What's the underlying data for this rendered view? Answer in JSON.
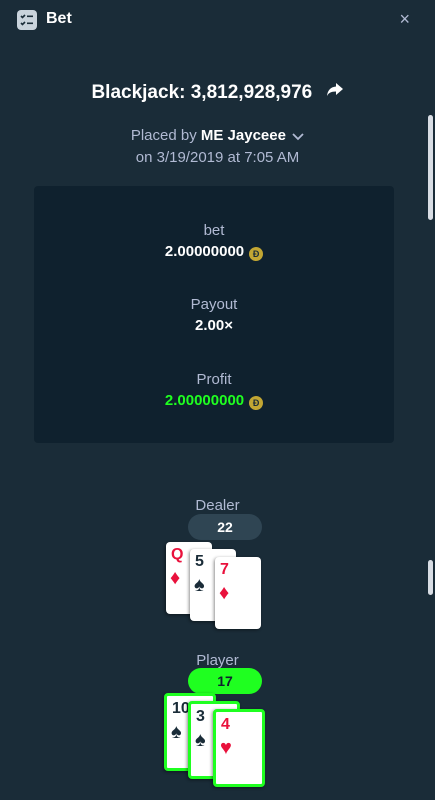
{
  "header": {
    "title": "Bet",
    "close_glyph": "×"
  },
  "bet": {
    "title": "Blackjack: 3,812,928,976",
    "placed_prefix": "Placed by",
    "user": "ME Jayceee",
    "date": "on 3/19/2019 at 7:05 AM"
  },
  "stats": {
    "bet_label": "bet",
    "bet_value": "2.00000000",
    "payout_label": "Payout",
    "payout_value": "2.00×",
    "profit_label": "Profit",
    "profit_value": "2.00000000",
    "currency_symbol": "Đ"
  },
  "dealer": {
    "label": "Dealer",
    "total": "22",
    "cards": [
      {
        "rank": "Q",
        "suit": "♦",
        "color": "red"
      },
      {
        "rank": "5",
        "suit": "♠",
        "color": "black"
      },
      {
        "rank": "7",
        "suit": "♦",
        "color": "red"
      }
    ]
  },
  "player": {
    "label": "Player",
    "total": "17",
    "cards": [
      {
        "rank": "10",
        "suit": "♠",
        "color": "black"
      },
      {
        "rank": "3",
        "suit": "♠",
        "color": "black"
      },
      {
        "rank": "4",
        "suit": "♥",
        "color": "red"
      }
    ]
  },
  "colors": {
    "background": "#1a2c38",
    "panel": "#0f212e",
    "win_green": "#1fff20",
    "muted": "#b1bad3"
  },
  "icons": [
    "bet-slip-icon",
    "close-icon",
    "share-icon",
    "chevron-down-icon",
    "coin-icon"
  ]
}
